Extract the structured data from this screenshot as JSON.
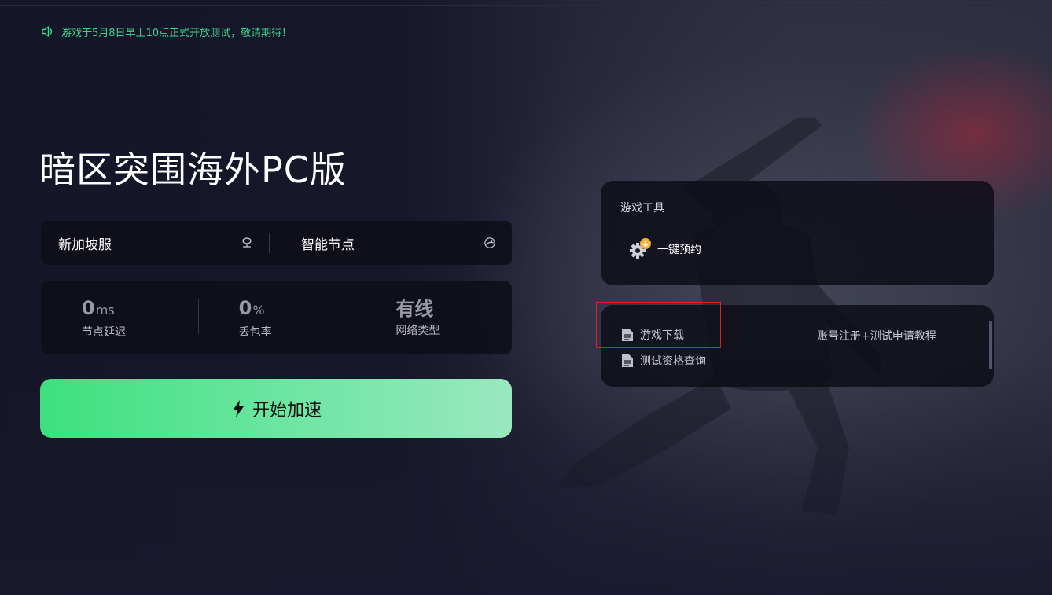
{
  "notice": {
    "text": "游戏于5月8日早上10点正式开放测试，敬请期待！"
  },
  "game": {
    "title": "暗区突围海外PC版"
  },
  "server": {
    "region_label": "新加坡服",
    "node_label": "智能节点"
  },
  "stats": [
    {
      "value": "0",
      "unit": "ms",
      "label": "节点延迟"
    },
    {
      "value": "0",
      "unit": "%",
      "label": "丢包率"
    },
    {
      "value": "有线",
      "unit": "",
      "label": "网络类型"
    }
  ],
  "start_button": {
    "label": "开始加速"
  },
  "tools": {
    "title": "游戏工具",
    "items": [
      {
        "label": "一键预约",
        "icon": "gear-download-icon"
      }
    ]
  },
  "links": [
    {
      "label": "游戏下载",
      "icon": "document-icon"
    },
    {
      "label": "账号注册+测试申请教程",
      "icon": ""
    },
    {
      "label": "测试资格查询",
      "icon": "document-icon"
    }
  ],
  "colors": {
    "accent": "#3ed68c",
    "button_start": "#3de07e",
    "button_end": "#9ae8be",
    "highlight": "#e02020"
  }
}
